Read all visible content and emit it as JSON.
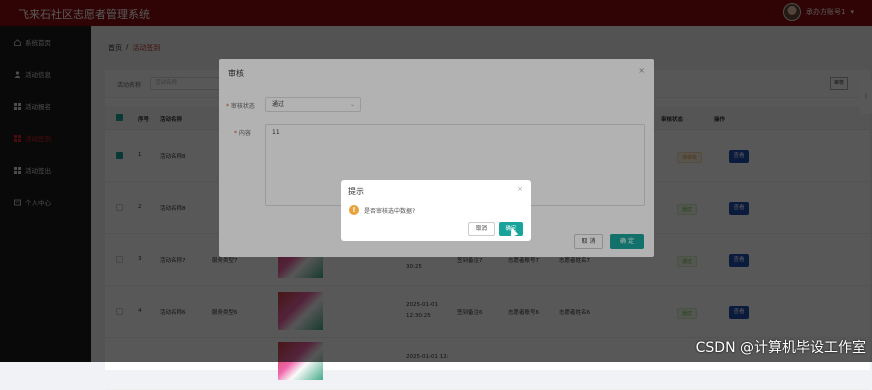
{
  "app": {
    "title": "飞来石社区志愿者管理系统",
    "user": "承办方账号1"
  },
  "sidebar": {
    "items": [
      {
        "label": "系统首页",
        "icon": "home-icon"
      },
      {
        "label": "活动信息",
        "icon": "user-icon"
      },
      {
        "label": "活动报名",
        "icon": "grid-icon"
      },
      {
        "label": "活动签到",
        "icon": "grid-icon",
        "active": true
      },
      {
        "label": "活动签出",
        "icon": "grid-icon"
      },
      {
        "label": "个人中心",
        "icon": "card-icon"
      }
    ]
  },
  "breadcrumb": {
    "home": "首页",
    "sep": "/",
    "current": "活动签到"
  },
  "search": {
    "label": "活动名称",
    "placeholder": "活动名称",
    "review_button": "审核"
  },
  "table": {
    "headers": {
      "no": "序号",
      "name": "活动名称",
      "status": "审核状态",
      "action": "操作"
    },
    "rows": [
      {
        "no": "1",
        "name": "活动名称8",
        "type": "",
        "time": "",
        "remark": "",
        "account": "",
        "username": "",
        "status": "待审核",
        "view": "查看"
      },
      {
        "no": "2",
        "name": "活动名称8",
        "type": "",
        "time": "",
        "remark": "",
        "account": "",
        "username": "",
        "status": "通过",
        "view": "查看"
      },
      {
        "no": "3",
        "name": "活动名称7",
        "type": "服务类型7",
        "time": "30:25",
        "remark": "签到备注7",
        "account": "志愿者账号7",
        "username": "志愿者姓名7",
        "status": "通过",
        "view": "查看"
      },
      {
        "no": "4",
        "name": "活动名称6",
        "type": "服务类型6",
        "time": "2025-01-01 12:30:25",
        "remark": "签到备注6",
        "account": "志愿者账号6",
        "username": "志愿者姓名6",
        "status": "通过",
        "view": "查看"
      },
      {
        "no": "",
        "name": "",
        "type": "",
        "time": "2025-01-01 12:",
        "remark": "",
        "account": "",
        "username": "",
        "status": "",
        "view": ""
      }
    ]
  },
  "dialog": {
    "title": "审核",
    "status_label": "审核状态",
    "status_value": "通过",
    "content_label": "内容",
    "content_value": "11",
    "cancel": "取 消",
    "ok": "确 定"
  },
  "confirm": {
    "title": "提示",
    "message": "是否审核选中数据?",
    "cancel": "取消",
    "ok": "确定"
  },
  "watermark": "CSDN @计算机毕设工作室"
}
